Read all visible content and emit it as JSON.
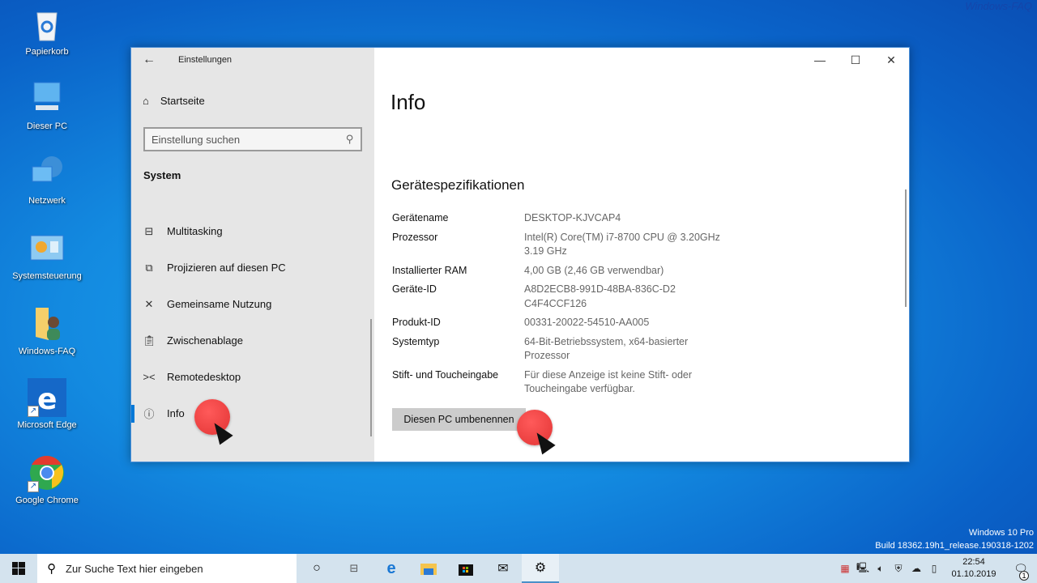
{
  "desktop": {
    "watermark": "Windows-FAQ",
    "icons": [
      {
        "label": "Papierkorb",
        "icon": "recycle-bin-icon"
      },
      {
        "label": "Dieser PC",
        "icon": "computer-icon"
      },
      {
        "label": "Netzwerk",
        "icon": "network-icon"
      },
      {
        "label": "Systemsteuerung",
        "icon": "control-panel-icon"
      },
      {
        "label": "Windows-FAQ",
        "icon": "user-folder-icon"
      },
      {
        "label": "Microsoft Edge",
        "icon": "edge-icon"
      },
      {
        "label": "Google Chrome",
        "icon": "chrome-icon"
      }
    ],
    "build_info": {
      "edition": "Windows 10 Pro",
      "build": "Build 18362.19h1_release.190318-1202"
    }
  },
  "window": {
    "app_title": "Einstellungen",
    "controls": {
      "minimize": "—",
      "maximize": "☐",
      "close": "✕"
    },
    "sidebar": {
      "home_label": "Startseite",
      "search_placeholder": "Einstellung suchen",
      "section_label": "System",
      "items": [
        {
          "label": "Multitasking",
          "icon": "multitasking-icon",
          "active": false
        },
        {
          "label": "Projizieren auf diesen PC",
          "icon": "project-icon",
          "active": false
        },
        {
          "label": "Gemeinsame Nutzung",
          "icon": "shared-experiences-icon",
          "active": false
        },
        {
          "label": "Zwischenablage",
          "icon": "clipboard-icon",
          "active": false
        },
        {
          "label": "Remotedesktop",
          "icon": "remote-desktop-icon",
          "active": false
        },
        {
          "label": "Info",
          "icon": "info-icon",
          "active": true
        }
      ]
    },
    "content": {
      "title": "Info",
      "section_title": "Gerätespezifikationen",
      "specs": [
        {
          "key": "Gerätename",
          "value": "DESKTOP-KJVCAP4"
        },
        {
          "key": "Prozessor",
          "value": "Intel(R) Core(TM) i7-8700 CPU @ 3.20GHz 3.19 GHz"
        },
        {
          "key": "Installierter RAM",
          "value": "4,00 GB (2,46 GB verwendbar)"
        },
        {
          "key": "Geräte-ID",
          "value": "A8D2ECB8-991D-48BA-836C-D2C4F4CCF126"
        },
        {
          "key": "Produkt-ID",
          "value": "00331-20022-54510-AA005"
        },
        {
          "key": "Systemtyp",
          "value": "64-Bit-Betriebssystem, x64-basierter Prozessor"
        },
        {
          "key": "Stift- und Toucheingabe",
          "value": "Für diese Anzeige ist keine Stift- oder Toucheingabe verfügbar."
        }
      ],
      "rename_button": "Diesen PC umbenennen"
    }
  },
  "taskbar": {
    "search_placeholder": "Zur Suche Text hier eingeben",
    "apps": [
      {
        "name": "cortana",
        "icon": "cortana-icon"
      },
      {
        "name": "task-view",
        "icon": "task-view-icon"
      },
      {
        "name": "edge",
        "icon": "edge-icon"
      },
      {
        "name": "file-explorer",
        "icon": "folder-icon"
      },
      {
        "name": "store",
        "icon": "store-icon"
      },
      {
        "name": "mail",
        "icon": "mail-icon"
      },
      {
        "name": "settings",
        "icon": "gear-icon",
        "active": true
      }
    ],
    "clock": {
      "time": "22:54",
      "date": "01.10.2019"
    },
    "notification_count": "1"
  },
  "accent_color": "#0078d7"
}
